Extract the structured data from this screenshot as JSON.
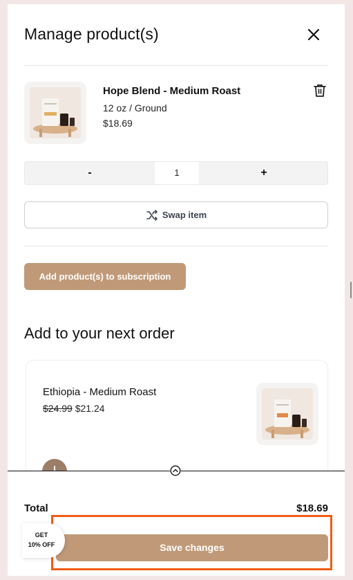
{
  "modal": {
    "title": "Manage product(s)",
    "close_icon": "close-icon"
  },
  "product": {
    "name": "Hope Blend - Medium Roast",
    "variant": "12 oz / Ground",
    "price": "$18.69",
    "delete_icon": "trash-icon"
  },
  "quantity": {
    "decrement_label": "-",
    "value": "1",
    "increment_label": "+"
  },
  "swap": {
    "label": "Swap item",
    "icon": "shuffle-icon"
  },
  "add_products": {
    "label": "Add product(s) to subscription"
  },
  "upsell": {
    "section_title": "Add to your next order",
    "item": {
      "name": "Ethiopia - Medium Roast",
      "original_price": "$24.99",
      "sale_price": "$21.24",
      "add_icon": "plus-icon"
    }
  },
  "footer": {
    "expand_icon": "chevron-up-icon",
    "total_label": "Total",
    "total_value": "$18.69",
    "save_label": "Save changes"
  },
  "discount_badge": {
    "line1": "GET",
    "line2": "10% OFF"
  },
  "colors": {
    "accent": "#c09a78",
    "highlight": "#f35b14",
    "background": "#f2e6e6"
  }
}
